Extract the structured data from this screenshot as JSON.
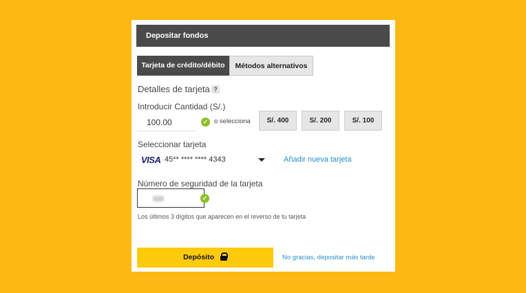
{
  "header": {
    "title": "Depositar fondos"
  },
  "tabs": [
    {
      "label": "Tarjeta de crédito/débito",
      "active": true
    },
    {
      "label": "Métodos alternativos",
      "active": false
    }
  ],
  "card_details": {
    "title": "Detalles de tarjeta",
    "help_glyph": "?",
    "amount_label": "Introducir Cantidad (S/.)",
    "amount_value": "100.00",
    "or_select_text": "o selecciona",
    "quick_amounts": [
      "S/. 400",
      "S/. 200",
      "S/. 100"
    ],
    "select_card_label": "Seleccionar tarjeta",
    "card_brand": "VISA",
    "card_number": "45** **** **** 4343",
    "add_card_link": "Añadir nueva tarjeta",
    "security_label": "Número de seguridad de la tarjeta",
    "security_hint": "Los últimos 3 dígitos que aparecen en el reverso de tu tarjeta"
  },
  "actions": {
    "deposit_label": "Depósito",
    "later_link": "No gracias, depositar más tarde"
  },
  "colors": {
    "background": "#FDB813",
    "header_bg": "#4a4a4a",
    "primary_button": "#FDCB0B",
    "link": "#2a8fc9",
    "valid_check": "#8cbf26"
  },
  "icons": [
    "help-icon",
    "valid-check-icon",
    "dropdown-arrow-icon",
    "lock-icon"
  ]
}
